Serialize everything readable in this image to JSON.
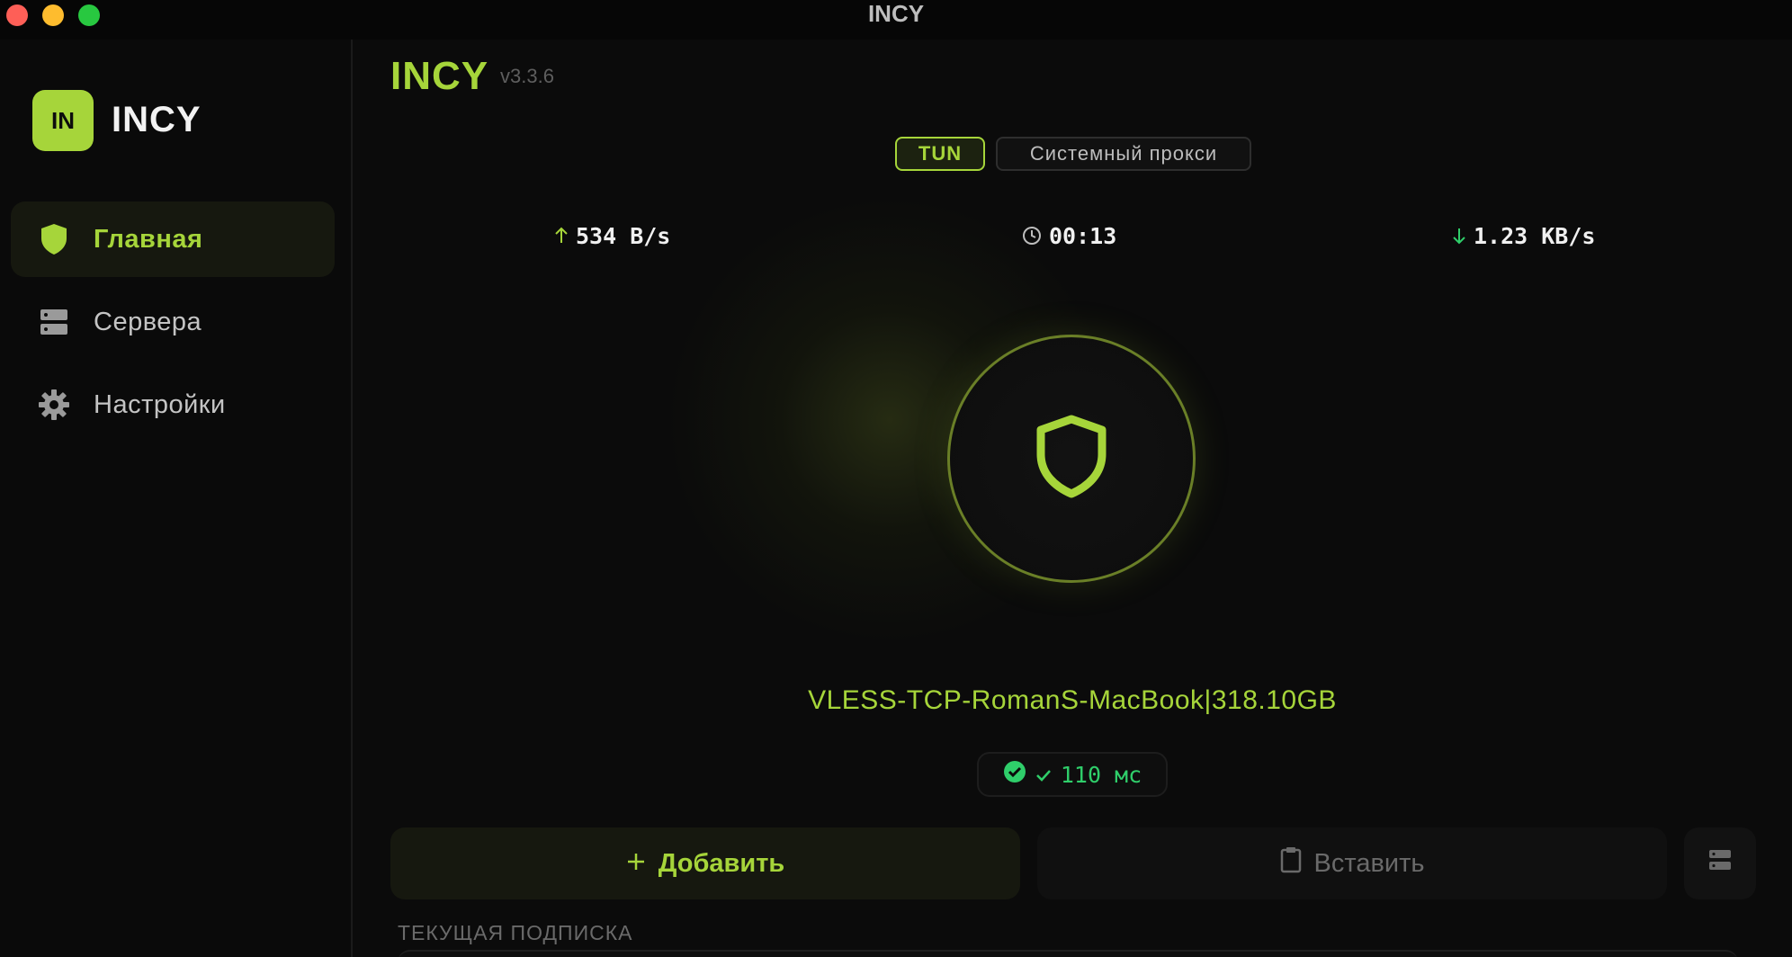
{
  "window": {
    "title": "INCY"
  },
  "sidebar": {
    "logo_text": "IN",
    "brand": "INCY",
    "items": [
      {
        "label": "Главная",
        "icon": "shield-icon",
        "active": true
      },
      {
        "label": "Сервера",
        "icon": "server-icon",
        "active": false
      },
      {
        "label": "Настройки",
        "icon": "gear-icon",
        "active": false
      }
    ]
  },
  "header": {
    "title": "INCY",
    "version": "v3.3.6"
  },
  "mode": {
    "options": [
      "TUN",
      "Системный прокси"
    ],
    "selected": "TUN"
  },
  "stats": {
    "upload": "534 B/s",
    "duration": "00:13",
    "download": "1.23 KB/s"
  },
  "connection": {
    "server_name": "VLESS-TCP-RomanS-MacBook|318.10GB",
    "ping": "110 мс"
  },
  "actions": {
    "add_label": "Добавить",
    "paste_label": "Вставить"
  },
  "subscription": {
    "section_title": "ТЕКУЩАЯ ПОДПИСКА"
  },
  "colors": {
    "accent": "#a6d53a",
    "background": "#0b0b0b",
    "ping_ok": "#2fce6a"
  }
}
